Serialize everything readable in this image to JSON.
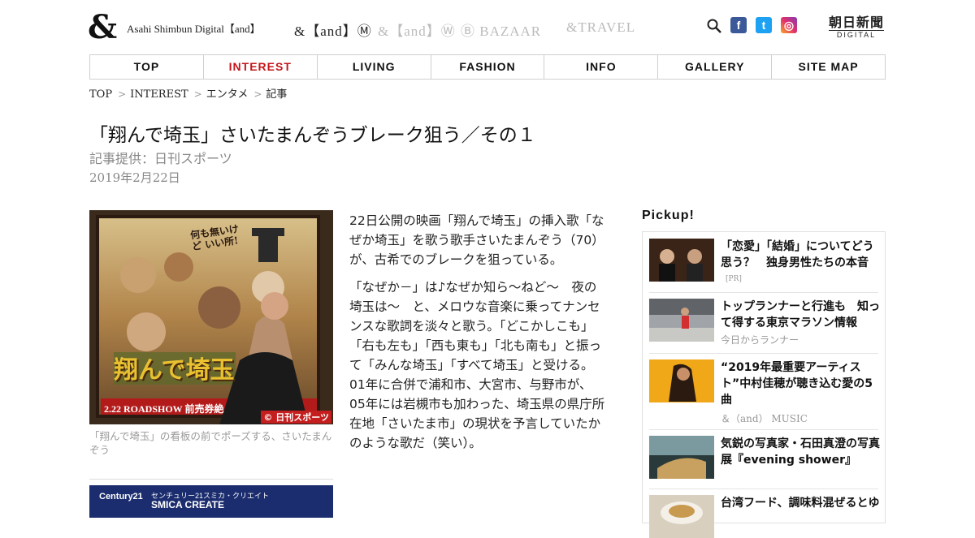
{
  "header": {
    "logo_mark": "&",
    "brand": "Asahi Shimbun Digital【and】",
    "subbrands": [
      {
        "label": "&【and】Ⓜ"
      },
      {
        "label": "&【and】Ⓦ"
      },
      {
        "label": "Ⓑ BAZAAR"
      },
      {
        "label": "&TRAVEL"
      }
    ],
    "social": [
      {
        "icon": "facebook-icon",
        "glyph": "f",
        "color": "#3b5998"
      },
      {
        "icon": "twitter-icon",
        "glyph": "t",
        "color": "#1da1f2"
      },
      {
        "icon": "instagram-icon",
        "glyph": "◎",
        "color": "#c13584"
      }
    ],
    "asahi_logo_line1": "朝日新聞",
    "asahi_logo_line2": "DIGITAL"
  },
  "nav": [
    {
      "label": "TOP",
      "active": false
    },
    {
      "label": "INTEREST",
      "active": true
    },
    {
      "label": "LIVING",
      "active": false
    },
    {
      "label": "FASHION",
      "active": false
    },
    {
      "label": "INFO",
      "active": false
    },
    {
      "label": "GALLERY",
      "active": false
    },
    {
      "label": "SITE MAP",
      "active": false
    }
  ],
  "breadcrumb": [
    "TOP",
    "INTEREST",
    "エンタメ",
    "記事"
  ],
  "article": {
    "title": "「翔んで埼玉」さいたまんぞうブレーク狙う／その１",
    "source": "記事提供：日刊スポーツ",
    "date": "2019年2月22日",
    "photo_poster_text": "翔んで埼玉",
    "photo_roadshow": "2.22 ROADSHOW 前売券絶",
    "photo_credit": "© 日刊スポーツ",
    "photo_top_text": "何も無いけど いい所!",
    "caption": "「翔んで埼玉」の看板の前でポーズする、さいたまんぞう",
    "paragraphs": [
      "22日公開の映画「翔んで埼玉」の挿入歌「なぜか埼玉」を歌う歌手さいたまんぞう（70）が、古希でのブレークを狙っている。",
      "「なぜか－」は♪なぜか知ら～ねど～　夜の埼玉は～　と、メロウな音楽に乗ってナンセンスな歌詞を淡々と歌う。「どこかしこも」「右も左も」「西も東も」「北も南も」と振って「みんな埼玉」「すべて埼玉」と受ける。01年に合併で浦和市、大宮市、与野市が、05年には岩槻市も加わった、埼玉県の県庁所在地「さいたま市」の現状を予言していたかのような歌だ（笑い）。"
    ]
  },
  "ad": {
    "logo": "Century21",
    "line1": "センチュリー21スミカ・クリエイト",
    "line2": "SMICA CREATE"
  },
  "pickup": {
    "heading": "Pickup!",
    "items": [
      {
        "title": "「恋愛」「結婚」についてどう思う？　独身男性たちの本音",
        "sub": "[PR]"
      },
      {
        "title": "トップランナーと行進も　知って得する東京マラソン情報",
        "sub": "今日からランナー"
      },
      {
        "title": "“2019年最重要アーティスト”中村佳穂が聴き込む愛の5曲",
        "sub": "＆（and） MUSIC"
      },
      {
        "title": "気鋭の写真家・石田真澄の写真展『evening shower』",
        "sub": ""
      },
      {
        "title": "台湾フード、調味料混ぜるとゆ",
        "sub": ""
      }
    ]
  }
}
